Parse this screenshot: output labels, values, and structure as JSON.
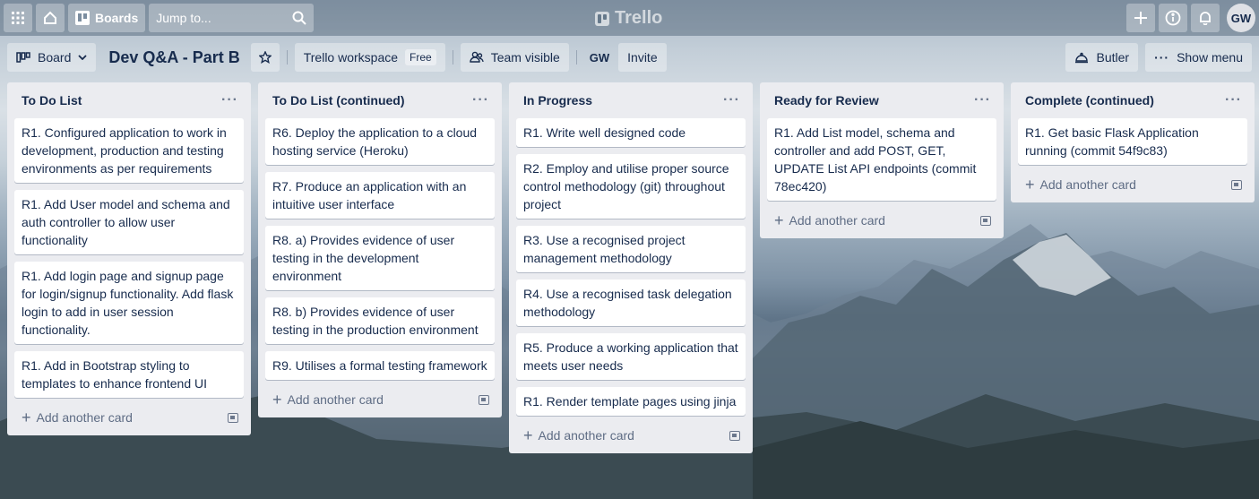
{
  "topbar": {
    "boards_label": "Boards",
    "search_placeholder": "Jump to...",
    "logo_text": "Trello",
    "avatar_initials": "GW",
    "icons": [
      "apps-grid-icon",
      "home-icon",
      "boards-icon",
      "search-icon",
      "plus-icon",
      "info-icon",
      "bell-icon"
    ]
  },
  "boardbar": {
    "view_label": "Board",
    "title": "Dev Q&A - Part B",
    "workspace_label": "Trello workspace",
    "workspace_badge": "Free",
    "visibility_label": "Team visible",
    "member_initials": "GW",
    "invite_label": "Invite",
    "butler_label": "Butler",
    "menu_label": "Show menu"
  },
  "lists": [
    {
      "title": "To Do List",
      "add_label": "Add another card",
      "cards": [
        "R1. Configured application to work in development, production and testing environments as per requirements",
        "R1. Add User model and schema and auth controller to allow user functionality",
        "R1. Add login page and signup page for login/signup functionality. Add flask login to add in user session functionality.",
        "R1. Add in Bootstrap styling to templates to enhance frontend UI"
      ]
    },
    {
      "title": "To Do List (continued)",
      "add_label": "Add another card",
      "cards": [
        "R6. Deploy the application to a cloud hosting service (Heroku)",
        "R7. Produce an application with an intuitive user interface",
        "R8. a) Provides evidence of user testing in the development environment",
        "R8. b) Provides evidence of user testing in the production environment",
        "R9. Utilises a formal testing framework"
      ]
    },
    {
      "title": "In Progress",
      "add_label": "Add another card",
      "cards": [
        "R1. Write well designed code",
        "R2. Employ and utilise proper source control methodology (git) throughout project",
        "R3. Use a recognised project management methodology",
        "R4. Use a recognised task delegation methodology",
        "R5. Produce a working application that meets user needs",
        "R1. Render template pages using jinja"
      ]
    },
    {
      "title": "Ready for Review",
      "add_label": "Add another card",
      "cards": [
        "R1. Add List model, schema and controller and add POST, GET, UPDATE List API endpoints (commit 78ec420)"
      ]
    },
    {
      "title": "Complete (continued)",
      "add_label": "Add another card",
      "cards": [
        "R1. Get basic Flask Application running (commit 54f9c83)"
      ]
    }
  ],
  "list_menu_glyph": "···"
}
